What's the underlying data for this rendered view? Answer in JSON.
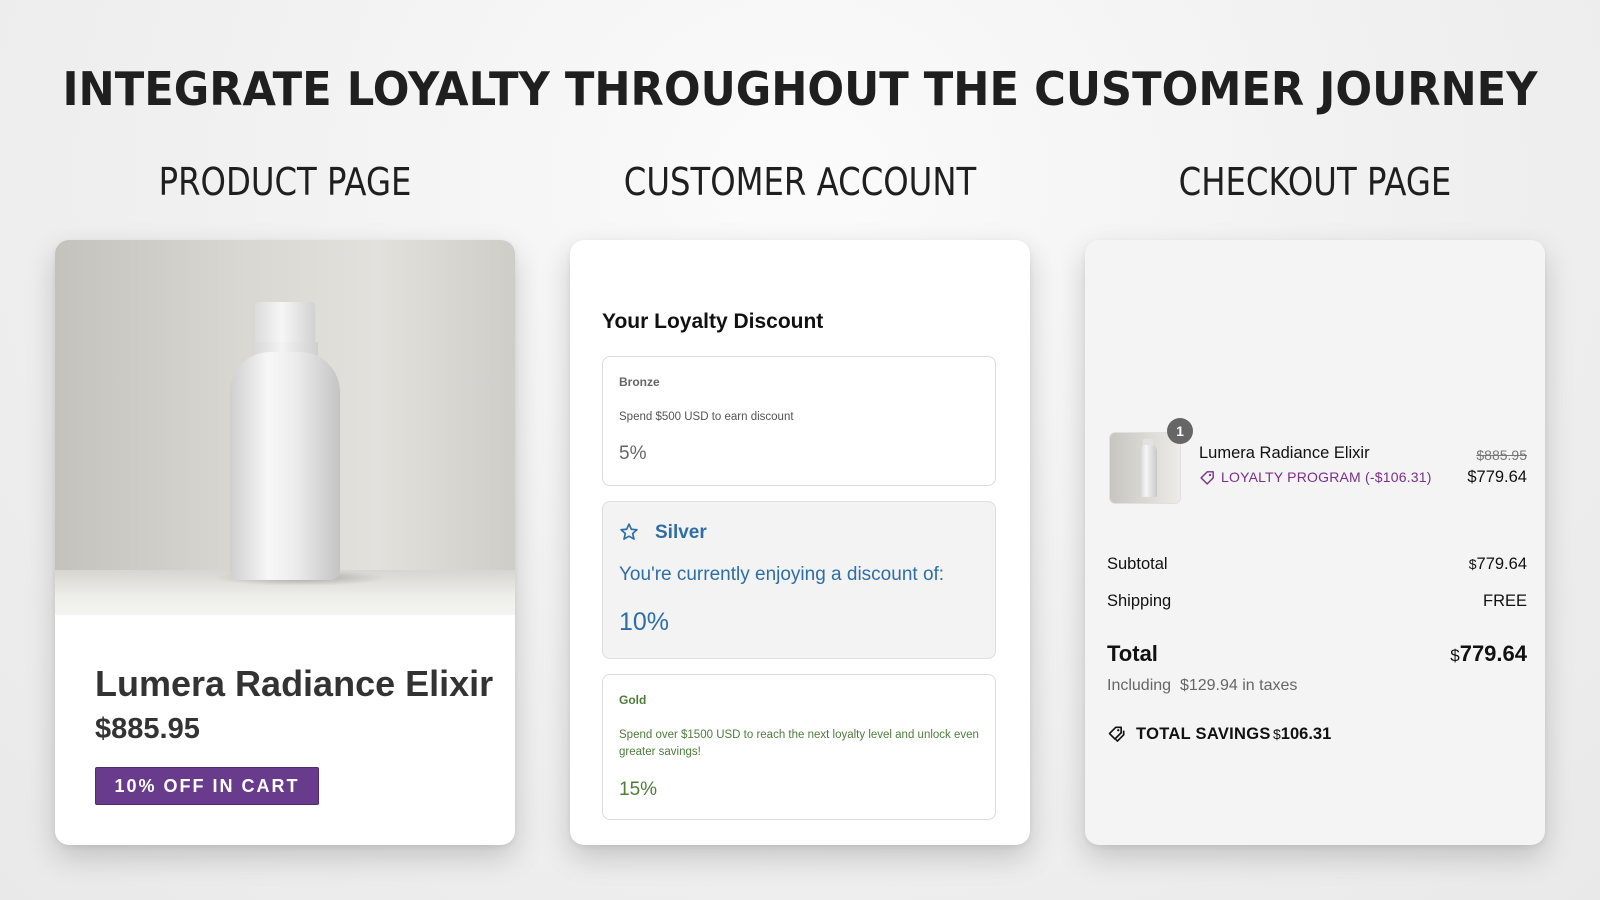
{
  "page": {
    "title": "INTEGRATE LOYALTY THROUGHOUT THE CUSTOMER JOURNEY",
    "sections": [
      "PRODUCT PAGE",
      "CUSTOMER ACCOUNT",
      "CHECKOUT PAGE"
    ]
  },
  "product_page": {
    "image_icon": "white-bottle-product-photo",
    "name": "Lumera Radiance Elixir",
    "price": "$885.95",
    "badge": "10% OFF IN CART",
    "badge_color": "#693b8d"
  },
  "customer_account": {
    "heading": "Your Loyalty Discount",
    "tiers": [
      {
        "name": "Bronze",
        "description": "Spend $500 USD to earn discount",
        "discount": "5%"
      },
      {
        "name": "Silver",
        "description": "You're currently enjoying a discount of:",
        "discount": "10%",
        "icon": "star-icon",
        "current": true,
        "color": "#2e6ea6"
      },
      {
        "name": "Gold",
        "description": "Spend over $1500 USD to reach the next loyalty level and unlock even greater savings!",
        "discount": "15%",
        "color": "#4e7d3b"
      }
    ]
  },
  "checkout": {
    "line_item": {
      "quantity": "1",
      "name": "Lumera Radiance Elixir",
      "discount_tag": "LOYALTY PROGRAM (-$106.31)",
      "original_price": "$885.95",
      "price": "$779.64",
      "tag_color": "#7b2f8d"
    },
    "subtotal_label": "Subtotal",
    "subtotal_currency": "$",
    "subtotal_value": "779.64",
    "shipping_label": "Shipping",
    "shipping_value": "FREE",
    "total_label": "Total",
    "total_currency": "$",
    "total_value": "779.64",
    "tax_note": "Including  $129.94 in taxes",
    "savings_label": "TOTAL SAVINGS",
    "savings_currency": "$",
    "savings_value": "106.31"
  }
}
